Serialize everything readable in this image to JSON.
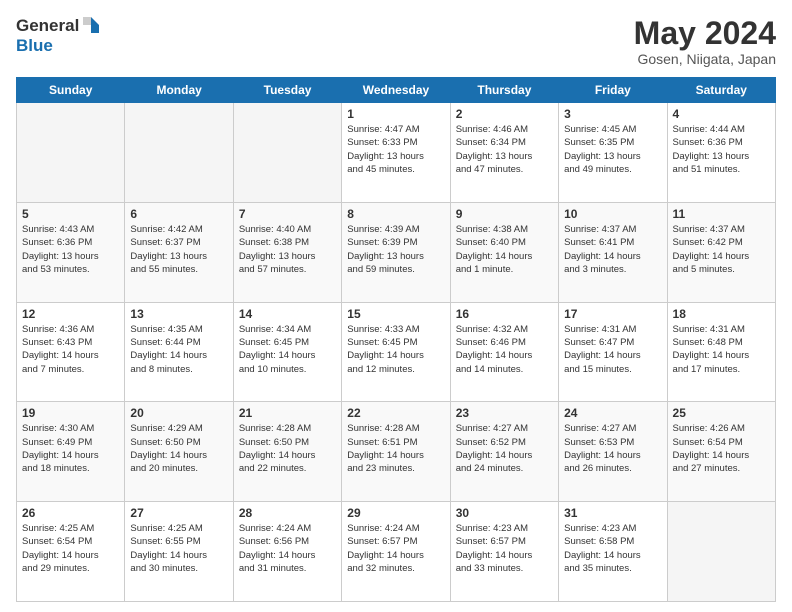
{
  "header": {
    "logo_general": "General",
    "logo_blue": "Blue",
    "month_title": "May 2024",
    "location": "Gosen, Niigata, Japan"
  },
  "weekdays": [
    "Sunday",
    "Monday",
    "Tuesday",
    "Wednesday",
    "Thursday",
    "Friday",
    "Saturday"
  ],
  "weeks": [
    [
      {
        "day": "",
        "info": ""
      },
      {
        "day": "",
        "info": ""
      },
      {
        "day": "",
        "info": ""
      },
      {
        "day": "1",
        "info": "Sunrise: 4:47 AM\nSunset: 6:33 PM\nDaylight: 13 hours\nand 45 minutes."
      },
      {
        "day": "2",
        "info": "Sunrise: 4:46 AM\nSunset: 6:34 PM\nDaylight: 13 hours\nand 47 minutes."
      },
      {
        "day": "3",
        "info": "Sunrise: 4:45 AM\nSunset: 6:35 PM\nDaylight: 13 hours\nand 49 minutes."
      },
      {
        "day": "4",
        "info": "Sunrise: 4:44 AM\nSunset: 6:36 PM\nDaylight: 13 hours\nand 51 minutes."
      }
    ],
    [
      {
        "day": "5",
        "info": "Sunrise: 4:43 AM\nSunset: 6:36 PM\nDaylight: 13 hours\nand 53 minutes."
      },
      {
        "day": "6",
        "info": "Sunrise: 4:42 AM\nSunset: 6:37 PM\nDaylight: 13 hours\nand 55 minutes."
      },
      {
        "day": "7",
        "info": "Sunrise: 4:40 AM\nSunset: 6:38 PM\nDaylight: 13 hours\nand 57 minutes."
      },
      {
        "day": "8",
        "info": "Sunrise: 4:39 AM\nSunset: 6:39 PM\nDaylight: 13 hours\nand 59 minutes."
      },
      {
        "day": "9",
        "info": "Sunrise: 4:38 AM\nSunset: 6:40 PM\nDaylight: 14 hours\nand 1 minute."
      },
      {
        "day": "10",
        "info": "Sunrise: 4:37 AM\nSunset: 6:41 PM\nDaylight: 14 hours\nand 3 minutes."
      },
      {
        "day": "11",
        "info": "Sunrise: 4:37 AM\nSunset: 6:42 PM\nDaylight: 14 hours\nand 5 minutes."
      }
    ],
    [
      {
        "day": "12",
        "info": "Sunrise: 4:36 AM\nSunset: 6:43 PM\nDaylight: 14 hours\nand 7 minutes."
      },
      {
        "day": "13",
        "info": "Sunrise: 4:35 AM\nSunset: 6:44 PM\nDaylight: 14 hours\nand 8 minutes."
      },
      {
        "day": "14",
        "info": "Sunrise: 4:34 AM\nSunset: 6:45 PM\nDaylight: 14 hours\nand 10 minutes."
      },
      {
        "day": "15",
        "info": "Sunrise: 4:33 AM\nSunset: 6:45 PM\nDaylight: 14 hours\nand 12 minutes."
      },
      {
        "day": "16",
        "info": "Sunrise: 4:32 AM\nSunset: 6:46 PM\nDaylight: 14 hours\nand 14 minutes."
      },
      {
        "day": "17",
        "info": "Sunrise: 4:31 AM\nSunset: 6:47 PM\nDaylight: 14 hours\nand 15 minutes."
      },
      {
        "day": "18",
        "info": "Sunrise: 4:31 AM\nSunset: 6:48 PM\nDaylight: 14 hours\nand 17 minutes."
      }
    ],
    [
      {
        "day": "19",
        "info": "Sunrise: 4:30 AM\nSunset: 6:49 PM\nDaylight: 14 hours\nand 18 minutes."
      },
      {
        "day": "20",
        "info": "Sunrise: 4:29 AM\nSunset: 6:50 PM\nDaylight: 14 hours\nand 20 minutes."
      },
      {
        "day": "21",
        "info": "Sunrise: 4:28 AM\nSunset: 6:50 PM\nDaylight: 14 hours\nand 22 minutes."
      },
      {
        "day": "22",
        "info": "Sunrise: 4:28 AM\nSunset: 6:51 PM\nDaylight: 14 hours\nand 23 minutes."
      },
      {
        "day": "23",
        "info": "Sunrise: 4:27 AM\nSunset: 6:52 PM\nDaylight: 14 hours\nand 24 minutes."
      },
      {
        "day": "24",
        "info": "Sunrise: 4:27 AM\nSunset: 6:53 PM\nDaylight: 14 hours\nand 26 minutes."
      },
      {
        "day": "25",
        "info": "Sunrise: 4:26 AM\nSunset: 6:54 PM\nDaylight: 14 hours\nand 27 minutes."
      }
    ],
    [
      {
        "day": "26",
        "info": "Sunrise: 4:25 AM\nSunset: 6:54 PM\nDaylight: 14 hours\nand 29 minutes."
      },
      {
        "day": "27",
        "info": "Sunrise: 4:25 AM\nSunset: 6:55 PM\nDaylight: 14 hours\nand 30 minutes."
      },
      {
        "day": "28",
        "info": "Sunrise: 4:24 AM\nSunset: 6:56 PM\nDaylight: 14 hours\nand 31 minutes."
      },
      {
        "day": "29",
        "info": "Sunrise: 4:24 AM\nSunset: 6:57 PM\nDaylight: 14 hours\nand 32 minutes."
      },
      {
        "day": "30",
        "info": "Sunrise: 4:23 AM\nSunset: 6:57 PM\nDaylight: 14 hours\nand 33 minutes."
      },
      {
        "day": "31",
        "info": "Sunrise: 4:23 AM\nSunset: 6:58 PM\nDaylight: 14 hours\nand 35 minutes."
      },
      {
        "day": "",
        "info": ""
      }
    ]
  ]
}
